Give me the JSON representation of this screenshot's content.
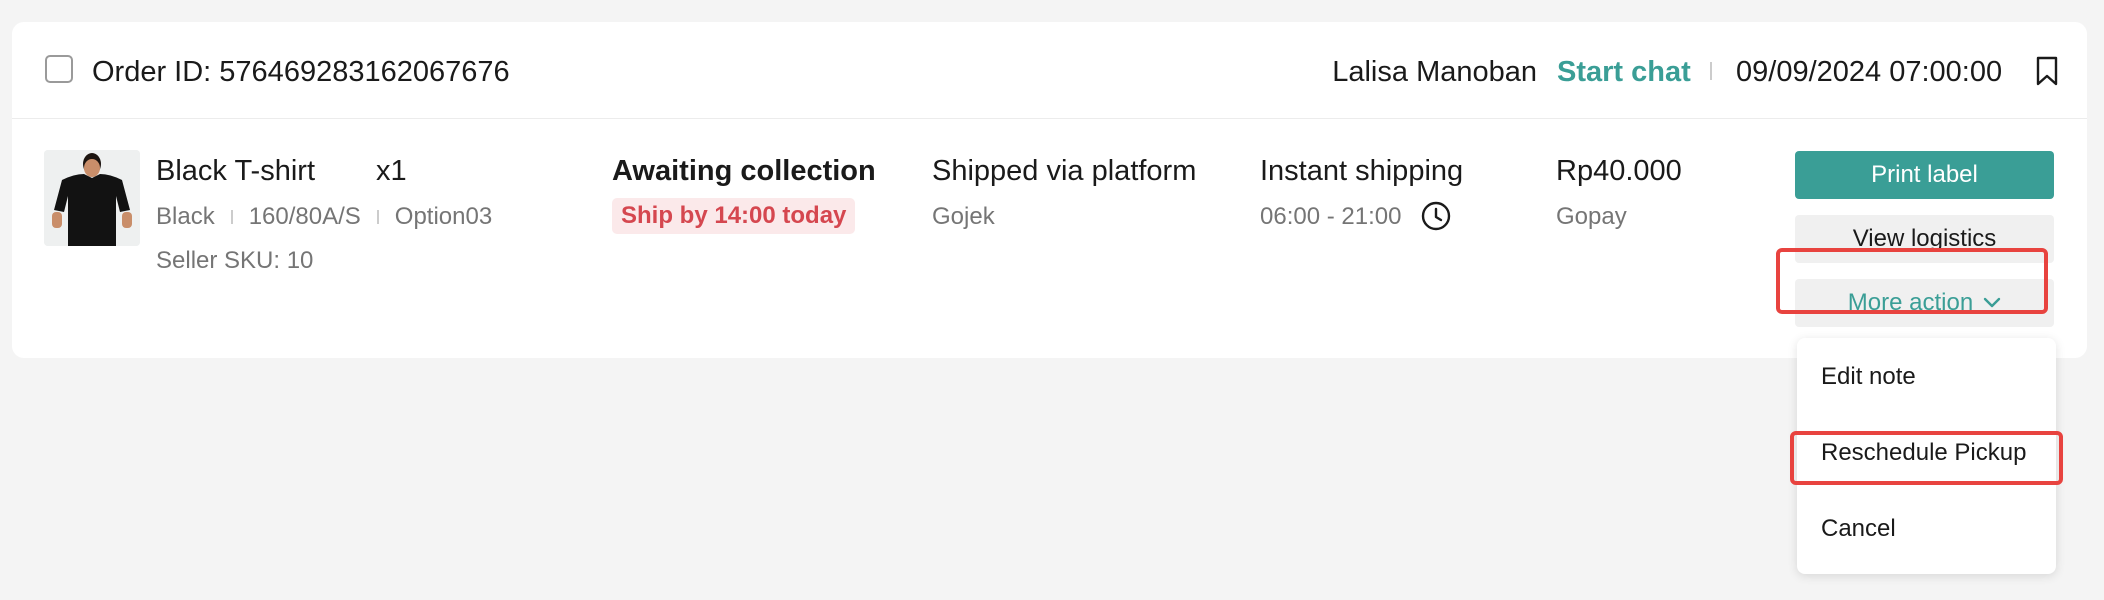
{
  "order": {
    "id_label": "Order ID: 576469283162067676",
    "buyer_name": "Lalisa Manoban",
    "start_chat_label": "Start chat",
    "created_at": "09/09/2024 07:00:00"
  },
  "product": {
    "name": "Black T-shirt",
    "quantity": "x1",
    "variant_color": "Black",
    "variant_size": "160/80A/S",
    "variant_option": "Option03",
    "seller_sku": "Seller SKU: 10"
  },
  "status": {
    "title": "Awaiting collection",
    "ship_by": "Ship by 14:00 today"
  },
  "shipping": {
    "method": "Shipped via platform",
    "courier": "Gojek"
  },
  "delivery": {
    "option": "Instant shipping",
    "window": "06:00 - 21:00"
  },
  "payment": {
    "price": "Rp40.000",
    "method": "Gopay"
  },
  "actions": {
    "print_label": "Print label",
    "view_logistics": "View logistics",
    "more_action": "More action"
  },
  "more_menu": {
    "items": [
      "Edit note",
      "Reschedule Pickup",
      "Cancel"
    ]
  },
  "colors": {
    "accent": "#3a9e96",
    "badge_text": "#d5474f",
    "badge_bg": "#fbe9ea",
    "highlight": "#e8433f"
  },
  "icons": {
    "bookmark": "bookmark-icon",
    "clock": "clock-icon",
    "chevron": "chevron-down-icon"
  }
}
